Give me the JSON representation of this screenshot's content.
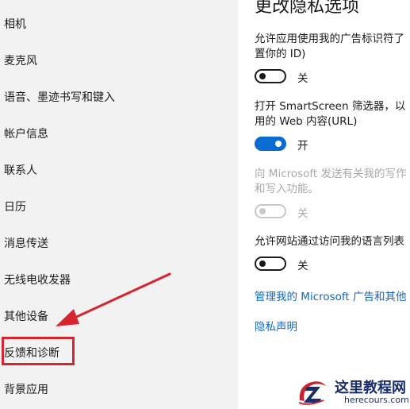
{
  "sidebar": {
    "items": [
      {
        "label": "相机"
      },
      {
        "label": "麦克风"
      },
      {
        "label": "语音、墨迹书写和键入"
      },
      {
        "label": "帐户信息"
      },
      {
        "label": "联系人"
      },
      {
        "label": "日历"
      },
      {
        "label": "消息传送"
      },
      {
        "label": "无线电收发器"
      },
      {
        "label": "其他设备"
      },
      {
        "label": "反馈和诊断"
      },
      {
        "label": "背景应用"
      }
    ]
  },
  "main": {
    "heading": "更改隐私选项",
    "settings": [
      {
        "line1": "允许应用使用我的广告标识符了",
        "line2": "置你的 ID)",
        "toggle": "off",
        "state_label": "关"
      },
      {
        "line1": "打开 SmartScreen 筛选器，以",
        "line2": "用的 Web 内容(URL)",
        "toggle": "on",
        "state_label": "开"
      },
      {
        "line1": "向 Microsoft 发送有关我的写作",
        "line2": "和写入功能。",
        "toggle": "disabled",
        "state_label": "关"
      },
      {
        "line1": "允许网站通过访问我的语言列表",
        "toggle": "off",
        "state_label": "关"
      }
    ],
    "links": [
      {
        "label": "管理我的 Microsoft 广告和其他"
      },
      {
        "label": "隐私声明"
      }
    ]
  },
  "annotation": {
    "highlight_color": "#d9232e",
    "arrow_color": "#d9232e"
  },
  "watermark": {
    "title": "这里教程网",
    "url": "herecours.com"
  },
  "colors": {
    "sidebar_bg": "#f2f2f2",
    "toggle_on": "#0a6cd1",
    "link": "#1565c0",
    "disabled_text": "#a8a8a8"
  }
}
